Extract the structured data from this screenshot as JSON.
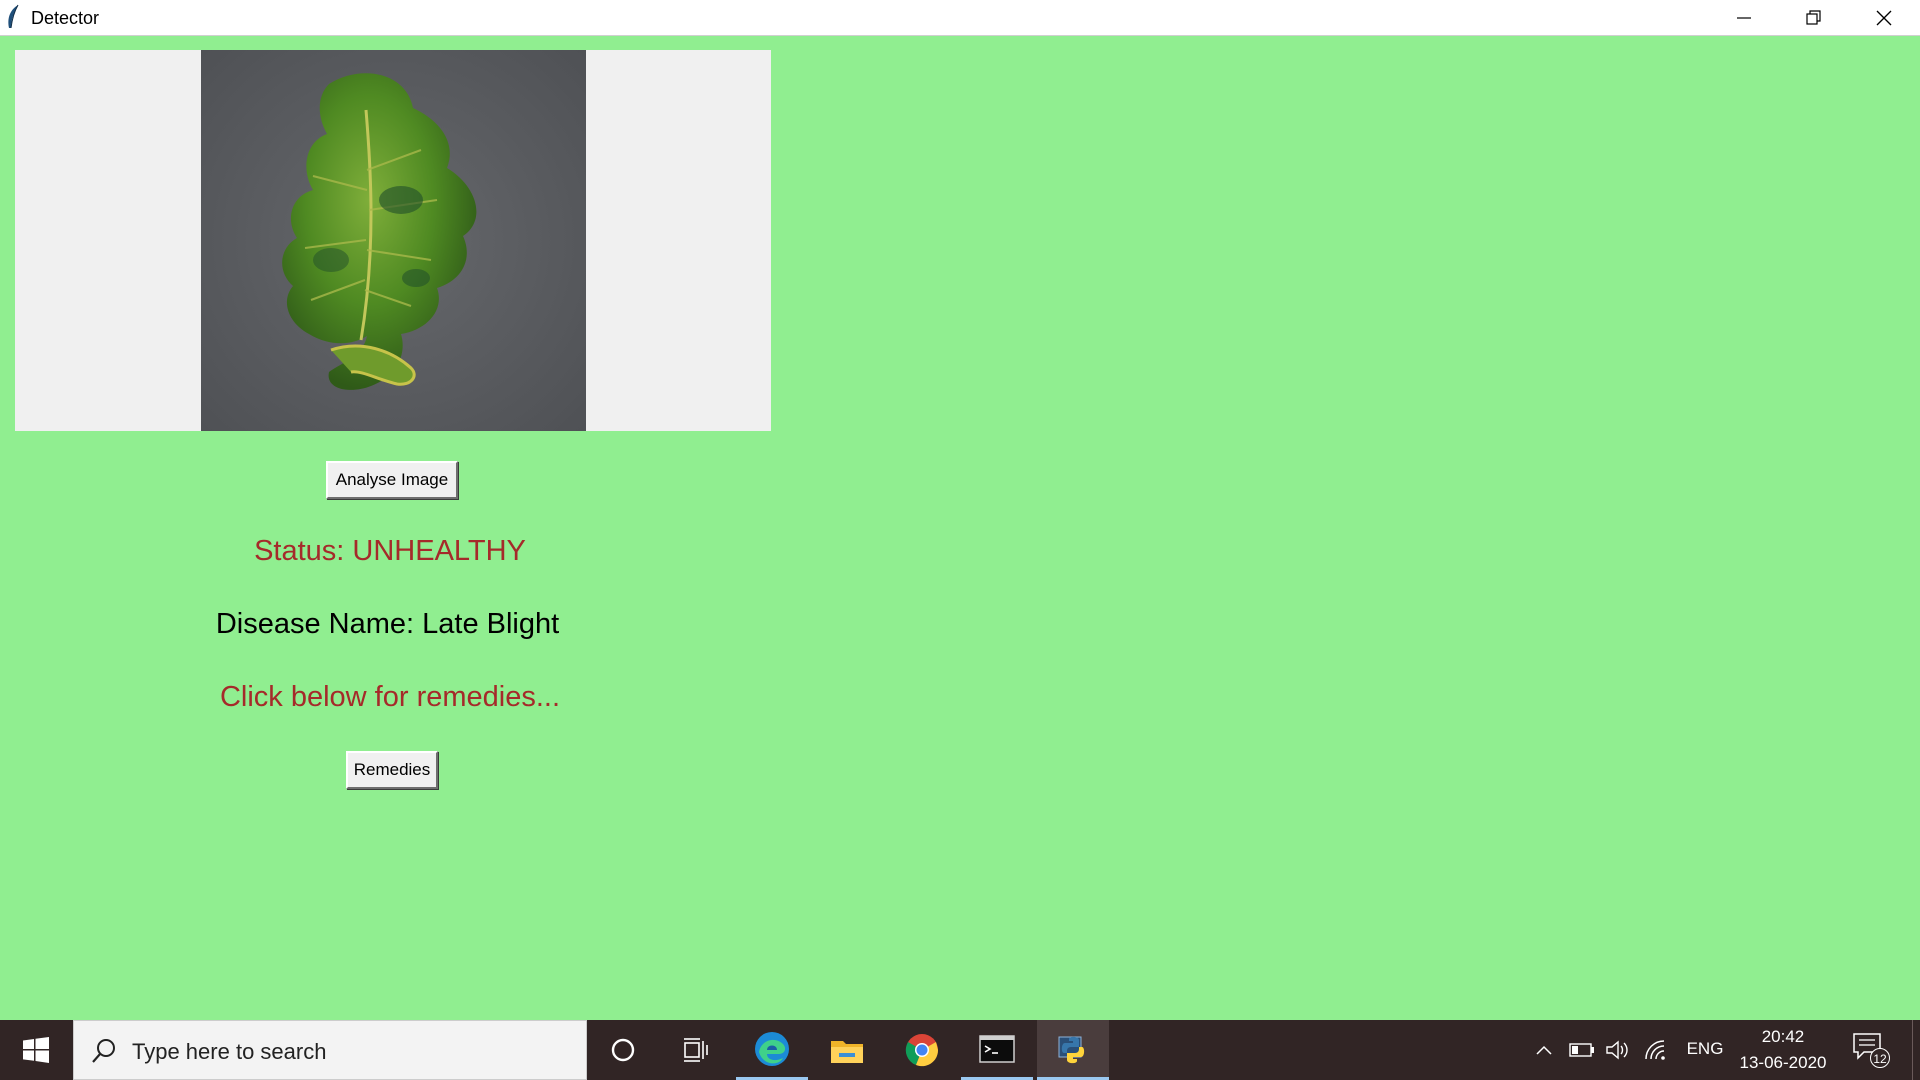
{
  "window": {
    "title": "Detector",
    "controls": {
      "minimize": "minimize-icon",
      "maximize": "restore-icon",
      "close": "close-icon"
    }
  },
  "main": {
    "analyse_button": "Analyse Image",
    "status": "Status: UNHEALTHY",
    "disease": "Disease Name: Late Blight",
    "remedy_hint": "Click below for remedies...",
    "remedies_button": "Remedies",
    "colors": {
      "background": "#90ee90",
      "status_text": "#a52a2a",
      "panel": "#f0f0f0"
    }
  },
  "taskbar": {
    "search_placeholder": "Type here to search",
    "apps": [
      "cortana-icon",
      "task-view-icon",
      "edge-icon",
      "file-explorer-icon",
      "chrome-icon",
      "terminal-icon",
      "python-icon"
    ],
    "tray": {
      "language": "ENG",
      "time": "20:42",
      "date": "13-06-2020",
      "notifications": "12"
    }
  }
}
